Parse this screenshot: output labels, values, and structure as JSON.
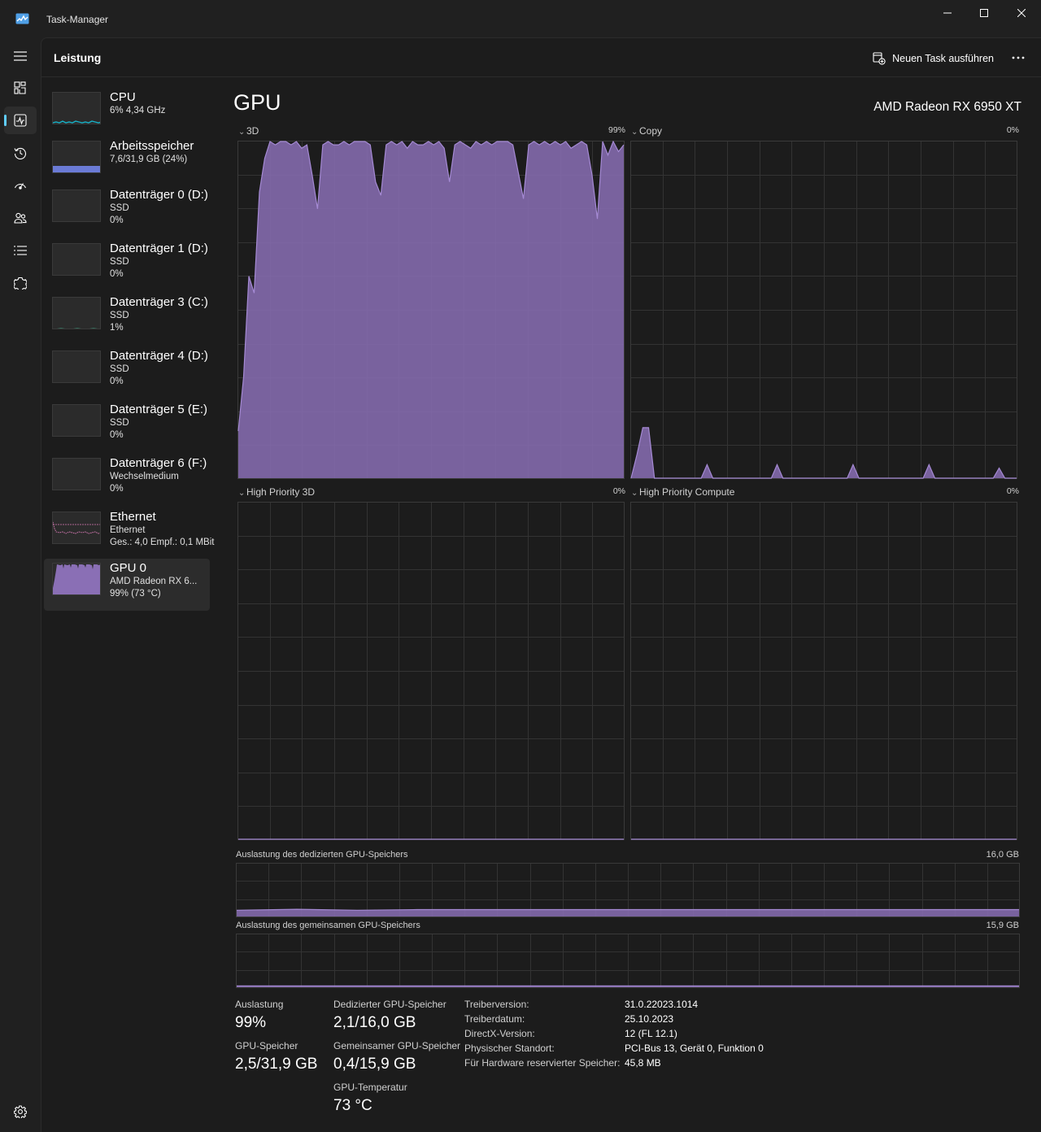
{
  "window": {
    "title": "Task-Manager"
  },
  "rail": {
    "items": [
      "menu-icon",
      "processes-icon",
      "performance-icon",
      "app-history-icon",
      "startup-apps-icon",
      "users-icon",
      "details-icon",
      "services-icon"
    ],
    "bottom": "settings-icon",
    "active": "performance-icon"
  },
  "header": {
    "title": "Leistung",
    "run_task_label": "Neuen Task ausführen"
  },
  "sidebar": {
    "items": [
      {
        "name": "CPU",
        "line1": "6% 4,34 GHz",
        "line2": ""
      },
      {
        "name": "Arbeitsspeicher",
        "line1": "7,6/31,9 GB (24%)",
        "line2": ""
      },
      {
        "name": "Datenträger 0 (D:)",
        "line1": "SSD",
        "line2": "0%"
      },
      {
        "name": "Datenträger 1 (D:)",
        "line1": "SSD",
        "line2": "0%"
      },
      {
        "name": "Datenträger 3 (C:)",
        "line1": "SSD",
        "line2": "1%"
      },
      {
        "name": "Datenträger 4 (D:)",
        "line1": "SSD",
        "line2": "0%"
      },
      {
        "name": "Datenträger 5 (E:)",
        "line1": "SSD",
        "line2": "0%"
      },
      {
        "name": "Datenträger 6 (F:)",
        "line1": "Wechselmedium",
        "line2": "0%"
      },
      {
        "name": "Ethernet",
        "line1": "Ethernet",
        "line2": "Ges.: 4,0 Empf.: 0,1 MBit"
      },
      {
        "name": "GPU 0",
        "line1": "AMD Radeon RX 6...",
        "line2": "99% (73 °C)"
      }
    ],
    "selected": "GPU 0"
  },
  "gpu": {
    "title": "GPU",
    "model": "AMD Radeon RX 6950 XT",
    "engines": [
      {
        "label": "3D",
        "percent": "99%"
      },
      {
        "label": "Copy",
        "percent": "0%"
      },
      {
        "label": "High Priority 3D",
        "percent": "0%"
      },
      {
        "label": "High Priority Compute",
        "percent": "0%"
      }
    ],
    "dedicated_memory": {
      "label": "Auslastung des dedizierten GPU-Speichers",
      "max": "16,0 GB"
    },
    "shared_memory": {
      "label": "Auslastung des gemeinsamen GPU-Speichers",
      "max": "15,9 GB"
    }
  },
  "stats": {
    "utilization_label": "Auslastung",
    "utilization_value": "99%",
    "dedicated_label": "Dedizierter GPU-Speicher",
    "dedicated_value": "2,1/16,0 GB",
    "gpu_memory_label": "GPU-Speicher",
    "gpu_memory_value": "2,5/31,9 GB",
    "shared_label": "Gemeinsamer GPU-Speicher",
    "shared_value": "0,4/15,9 GB",
    "temp_label": "GPU-Temperatur",
    "temp_value": "73 °C",
    "details": [
      {
        "key": "Treiberversion:",
        "value": "31.0.22023.1014"
      },
      {
        "key": "Treiberdatum:",
        "value": "25.10.2023"
      },
      {
        "key": "DirectX-Version:",
        "value": "12 (FL 12.1)"
      },
      {
        "key": "Physischer Standort:",
        "value": "PCI-Bus 13, Gerät 0, Funktion 0"
      },
      {
        "key": "Für Hardware reservierter Speicher:",
        "value": "45,8 MB"
      }
    ]
  },
  "chart_data": [
    {
      "type": "area",
      "title": "3D",
      "ylim": [
        0,
        100
      ],
      "values": [
        14,
        30,
        60,
        55,
        85,
        95,
        100,
        99,
        100,
        100,
        99,
        100,
        98,
        99,
        90,
        80,
        99,
        100,
        99,
        99,
        100,
        99,
        100,
        100,
        100,
        99,
        88,
        84,
        99,
        100,
        99,
        100,
        98,
        100,
        99,
        99,
        100,
        99,
        100,
        98,
        88,
        99,
        100,
        99,
        98,
        100,
        99,
        100,
        99,
        100,
        100,
        100,
        99,
        91,
        83,
        99,
        100,
        99,
        100,
        99,
        100,
        99,
        100,
        98,
        99,
        100,
        99,
        90,
        77,
        100,
        96,
        100,
        97,
        99
      ],
      "grid": true,
      "color": "#8a6fb5"
    },
    {
      "type": "area",
      "title": "Copy",
      "ylim": [
        0,
        100
      ],
      "values": [
        0,
        7,
        15,
        15,
        0,
        0,
        0,
        0,
        0,
        0,
        0,
        0,
        0,
        4,
        0,
        0,
        0,
        0,
        0,
        0,
        0,
        0,
        0,
        0,
        0,
        4,
        0,
        0,
        0,
        0,
        0,
        0,
        0,
        0,
        0,
        0,
        0,
        0,
        4,
        0,
        0,
        0,
        0,
        0,
        0,
        0,
        0,
        0,
        0,
        0,
        0,
        4,
        0,
        0,
        0,
        0,
        0,
        0,
        0,
        0,
        0,
        0,
        0,
        3,
        0,
        0,
        0
      ],
      "grid": true,
      "color": "#8a6fb5"
    },
    {
      "type": "area",
      "title": "High Priority 3D",
      "ylim": [
        0,
        100
      ],
      "values": [
        0
      ],
      "grid": true,
      "color": "#8a6fb5"
    },
    {
      "type": "area",
      "title": "High Priority Compute",
      "ylim": [
        0,
        100
      ],
      "values": [
        0
      ],
      "grid": true,
      "color": "#8a6fb5"
    },
    {
      "type": "area",
      "title": "Auslastung des dedizierten GPU-Speichers",
      "ylim": [
        0,
        16.0
      ],
      "values": [
        1.9,
        2.2,
        1.9,
        2.1,
        2.1,
        2.1,
        2.1,
        2.1,
        2.1,
        2.1,
        2.1,
        2.1,
        2.1,
        2.1
      ],
      "grid": true,
      "color": "#8a6fb5"
    },
    {
      "type": "area",
      "title": "Auslastung des gemeinsamen GPU-Speichers",
      "ylim": [
        0,
        15.9
      ],
      "values": [
        0.4,
        0.4,
        0.4,
        0.4
      ],
      "grid": true,
      "color": "#8a6fb5"
    }
  ],
  "thumbnails": {
    "cpu_color": "#17b3c9",
    "memory_color": "#6b7bd6",
    "disk_color": "#3bb38c",
    "ethernet_color": "#d77ab5",
    "gpu_color": "#8a6fb5"
  }
}
